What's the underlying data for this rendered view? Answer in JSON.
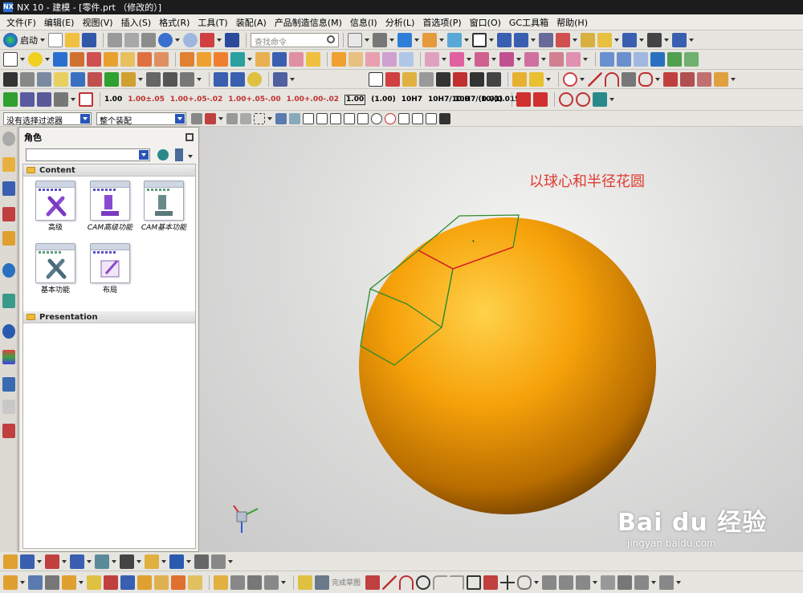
{
  "window": {
    "title": "NX 10 - 建模 - [零件.prt （修改的）]"
  },
  "menu": [
    "文件(F)",
    "编辑(E)",
    "视图(V)",
    "插入(S)",
    "格式(R)",
    "工具(T)",
    "装配(A)",
    "产品制造信息(M)",
    "信息(I)",
    "分析(L)",
    "首选项(P)",
    "窗口(O)",
    "GC工具箱",
    "帮助(H)"
  ],
  "toolbar": {
    "start_label": "启动",
    "search_placeholder": "查找命令",
    "dimension_buttons": [
      "1.00",
      "1.00±.05",
      "1.00+.05-.02",
      "1.00+.05-.00",
      "1.00+.00-.02",
      "1.00",
      "(1.00)",
      "10H7",
      "10H7/10.0",
      "10H7/(0.01)",
      "10/(0.015)"
    ]
  },
  "selection_bar": {
    "filter": "没有选择过滤器",
    "scope": "整个装配"
  },
  "navigator": {
    "title": "角色",
    "sections": [
      {
        "label": "Content",
        "items": [
          {
            "label": "高级",
            "icon": "tools-icon"
          },
          {
            "label": "CAM高级功能",
            "icon": "mill-icon"
          },
          {
            "label": "CAM基本功能",
            "icon": "mill-gray-icon"
          },
          {
            "label": "基本功能",
            "icon": "tools-icon"
          },
          {
            "label": "布局",
            "icon": "pencil-paper-icon"
          }
        ]
      },
      {
        "label": "Presentation",
        "items": []
      }
    ]
  },
  "viewport": {
    "annotation": "以球心和半径花圆",
    "sphere_color": "#f6a20a",
    "sketch_color": "#2e8b2e",
    "highlight_color": "#e02020"
  },
  "bottom_toolbar": {
    "finish_sketch_label": "完成草图"
  },
  "watermark": {
    "brand": "Bai du 经验",
    "url": "jingyan.baidu.com"
  }
}
